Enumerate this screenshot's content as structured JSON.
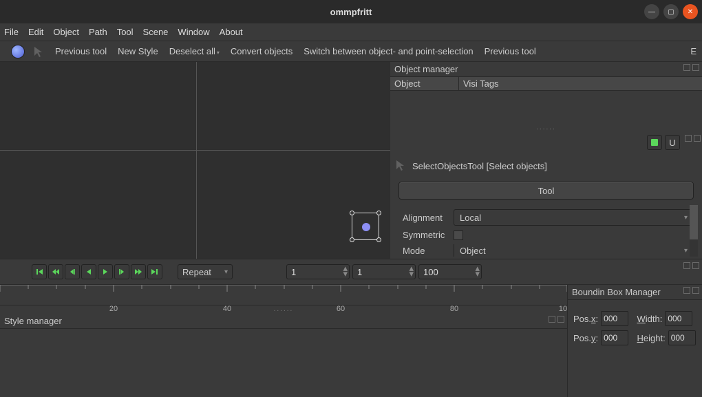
{
  "window": {
    "title": "ommpfritt"
  },
  "menu": {
    "items": [
      "File",
      "Edit",
      "Object",
      "Path",
      "Tool",
      "Scene",
      "Window",
      "About"
    ]
  },
  "toolbar": {
    "previous_tool": "Previous tool",
    "new_style": "New Style",
    "deselect_all": "Deselect all",
    "convert_objects": "Convert objects",
    "switch_selection": "Switch between object- and point-selection",
    "previous_tool2": "Previous tool",
    "right_letter": "E"
  },
  "object_manager": {
    "title": "Object manager",
    "col_object": "Object",
    "col_visi_tags": "Visi Tags",
    "u_button": "U"
  },
  "tool_panel": {
    "header": "SelectObjectsTool [Select objects]",
    "tool_button": "Tool",
    "alignment_label": "Alignment",
    "alignment_value": "Local",
    "symmetric_label": "Symmetric",
    "mode_label": "Mode",
    "mode_value": "Object"
  },
  "timeline": {
    "repeat": "Repeat",
    "frame_a": "1",
    "frame_b": "1",
    "frame_c": "100",
    "ruler": [
      "20",
      "40",
      "60",
      "80",
      "10"
    ]
  },
  "style_manager": {
    "title": "Style manager"
  },
  "bbm": {
    "title": "Boundin Box Manager",
    "posx": "Pos.x:",
    "posx_val": "000",
    "posy": "Pos.y:",
    "posy_val": "000",
    "width": "Width:",
    "width_val": "000",
    "height": "Height:",
    "height_val": "000"
  }
}
